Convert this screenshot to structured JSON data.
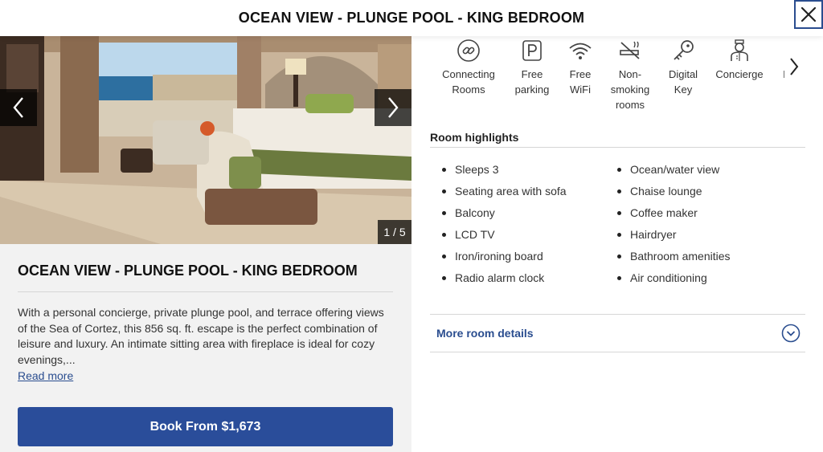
{
  "header": {
    "title": "OCEAN VIEW - PLUNGE POOL - KING BEDROOM",
    "close_icon": "close-icon"
  },
  "gallery": {
    "counter": "1 / 5",
    "prev_icon": "chevron-left-icon",
    "next_icon": "chevron-right-icon"
  },
  "room": {
    "title": "OCEAN VIEW - PLUNGE POOL - KING BEDROOM",
    "description": "With a personal concierge, private plunge pool, and terrace offering views of the Sea of Cortez, this 856 sq. ft. escape is the perfect combination of leisure and luxury. An intimate sitting area with fireplace is ideal for cozy evenings,...",
    "read_more": "Read more",
    "book_label": "Book From $1,673"
  },
  "amenities": [
    {
      "line1": "Connecting",
      "line2": "Rooms",
      "line3": "",
      "icon": "link-icon"
    },
    {
      "line1": "Free",
      "line2": "parking",
      "line3": "",
      "icon": "parking-icon"
    },
    {
      "line1": "Free",
      "line2": "WiFi",
      "line3": "",
      "icon": "wifi-icon"
    },
    {
      "line1": "Non-",
      "line2": "smoking",
      "line3": "rooms",
      "icon": "no-smoking-icon"
    },
    {
      "line1": "Digital",
      "line2": "Key",
      "line3": "",
      "icon": "key-icon"
    },
    {
      "line1": "Concierge",
      "line2": "",
      "line3": "",
      "icon": "concierge-icon"
    },
    {
      "line1": "",
      "line2": "Resi",
      "line3": "",
      "icon": "partial-amenity-icon"
    }
  ],
  "highlights": {
    "title": "Room highlights",
    "col1": [
      "Sleeps 3",
      "Seating area with sofa",
      "Balcony",
      "LCD TV",
      "Iron/ironing board",
      "Radio alarm clock"
    ],
    "col2": [
      "Ocean/water view",
      "Chaise lounge",
      "Coffee maker",
      "Hairdryer",
      "Bathroom amenities",
      "Air conditioning"
    ]
  },
  "more_details": {
    "label": "More room details",
    "icon": "chevron-down-circle-icon"
  },
  "colors": {
    "brand_blue": "#2a4d9a",
    "link_blue": "#2a4d8f",
    "left_panel_bg": "#f2f2f2"
  }
}
